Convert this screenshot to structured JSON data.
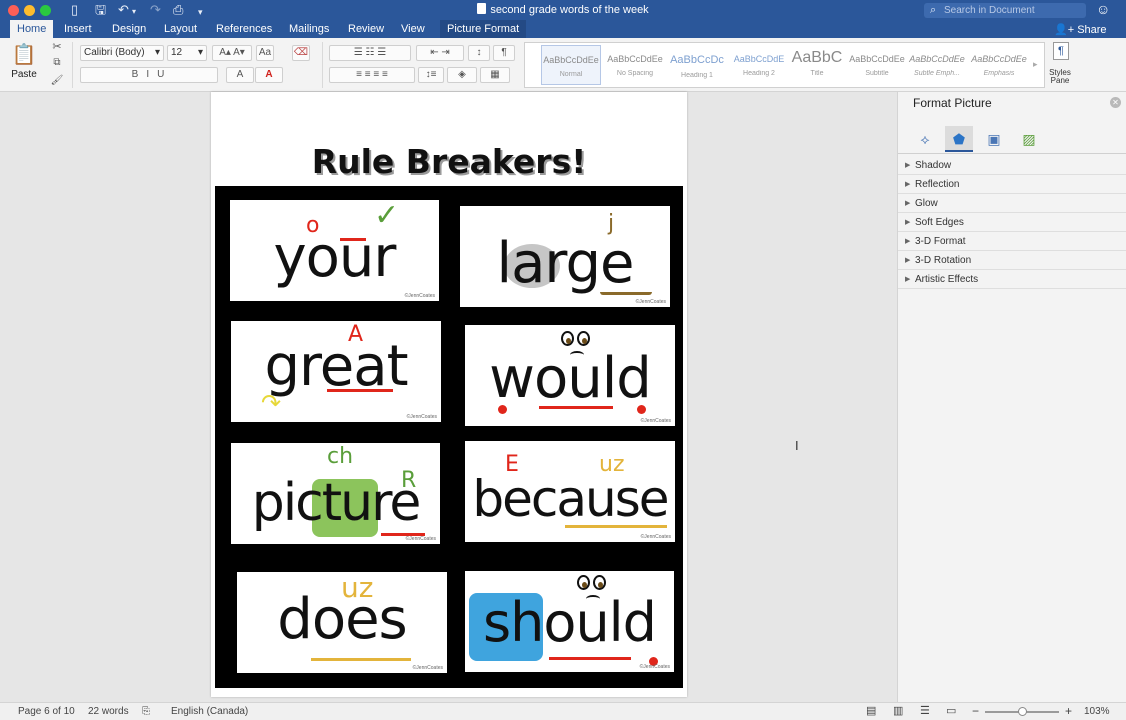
{
  "window": {
    "title": "second grade words of the week",
    "search_placeholder": "Search in Document",
    "share_label": "Share"
  },
  "tabs": [
    "Home",
    "Insert",
    "Design",
    "Layout",
    "References",
    "Mailings",
    "Review",
    "View",
    "Picture Format"
  ],
  "active_tab": "Home",
  "ribbon": {
    "paste_label": "Paste",
    "font_name": "Calibri (Body)",
    "font_size": "12",
    "styles": [
      {
        "sample": "AaBbCcDdEe",
        "name": "Normal"
      },
      {
        "sample": "AaBbCcDdEe",
        "name": "No Spacing"
      },
      {
        "sample": "AaBbCcDc",
        "name": "Heading 1"
      },
      {
        "sample": "AaBbCcDdE",
        "name": "Heading 2"
      },
      {
        "sample": "AaBbC",
        "name": "Title"
      },
      {
        "sample": "AaBbCcDdEe",
        "name": "Subtitle"
      },
      {
        "sample": "AaBbCcDdEe",
        "name": "Subtle Emph..."
      },
      {
        "sample": "AaBbCcDdEe",
        "name": "Emphasis"
      }
    ],
    "styles_pane_label": "Styles Pane"
  },
  "document": {
    "heading": "Rule Breakers!",
    "credit": "©JennCoates",
    "cards": [
      {
        "word": "your",
        "marks": [
          "o",
          "✓"
        ]
      },
      {
        "word": "large",
        "marks": [
          "j"
        ]
      },
      {
        "word": "great",
        "marks": [
          "A"
        ]
      },
      {
        "word": "would",
        "marks": []
      },
      {
        "word": "picture",
        "marks": [
          "ch",
          "R"
        ]
      },
      {
        "word": "because",
        "marks": [
          "E",
          "uz"
        ]
      },
      {
        "word": "does",
        "marks": [
          "uz"
        ]
      },
      {
        "word": "should",
        "marks": []
      }
    ]
  },
  "pane": {
    "title": "Format Picture",
    "sections": [
      "Shadow",
      "Reflection",
      "Glow",
      "Soft Edges",
      "3-D Format",
      "3-D Rotation",
      "Artistic Effects"
    ]
  },
  "status": {
    "page": "Page 6 of 10",
    "words": "22 words",
    "language": "English (Canada)",
    "zoom": "103%"
  },
  "colors": {
    "accent": "#2b579a",
    "red_mark": "#e0261b",
    "green_mark": "#5a9e3a",
    "yellow_mark": "#e3b43b",
    "highlight_green": "#8cc45c",
    "highlight_blue": "#3fa4de"
  }
}
